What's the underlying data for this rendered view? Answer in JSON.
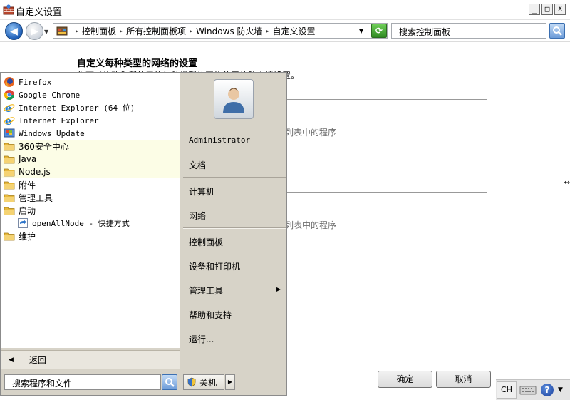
{
  "window": {
    "title": "自定义设置",
    "min_label": "_",
    "max_label": "□",
    "close_label": "X"
  },
  "navigation": {
    "back_glyph": "◀",
    "forward_glyph": "▶",
    "history_glyph": "▼",
    "breadcrumbs": [
      "控制面板",
      "所有控制面板项",
      "Windows 防火墙",
      "自定义设置"
    ],
    "crumb_separator": "▸",
    "dropdown_glyph": "▼",
    "refresh_glyph": "⟳",
    "search_placeholder": "搜索控制面板"
  },
  "content": {
    "heading": "自定义每种类型的网络的设置",
    "description": "您可以修改您所使用的每种类型的网络位置的防火墙设置。",
    "section1_text": "列表中的程序",
    "section2_text": "列表中的程序",
    "ok_label": "确定",
    "cancel_label": "取消",
    "edge_glyph": "↔"
  },
  "start_menu": {
    "programs": [
      {
        "label": "Firefox",
        "icon": "firefox-icon",
        "type": "app"
      },
      {
        "label": "Google Chrome",
        "icon": "chrome-icon",
        "type": "app"
      },
      {
        "label": "Internet Explorer (64 位)",
        "icon": "ie-icon",
        "type": "app"
      },
      {
        "label": "Internet Explorer",
        "icon": "ie-icon",
        "type": "app"
      },
      {
        "label": "Windows Update",
        "icon": "windows-update-icon",
        "type": "app"
      },
      {
        "label": "360安全中心",
        "icon": "folder-icon",
        "type": "folder",
        "highlight": true
      },
      {
        "label": "Java",
        "icon": "folder-icon",
        "type": "folder",
        "highlight": true
      },
      {
        "label": "Node.js",
        "icon": "folder-icon",
        "type": "folder",
        "highlight": true
      },
      {
        "label": "附件",
        "icon": "folder-icon",
        "type": "folder"
      },
      {
        "label": "管理工具",
        "icon": "folder-icon",
        "type": "folder"
      },
      {
        "label": "启动",
        "icon": "folder-icon",
        "type": "folder"
      },
      {
        "label": "openAllNode - 快捷方式",
        "icon": "shortcut-icon",
        "type": "sub"
      },
      {
        "label": "维护",
        "icon": "folder-icon",
        "type": "folder"
      }
    ],
    "back_glyph": "◀",
    "back_label": "返回",
    "search_placeholder": "搜索程序和文件",
    "user_name": "Administrator",
    "right_items": {
      "documents": "文档",
      "computer": "计算机",
      "network": "网络",
      "control_panel": "控制面板",
      "devices_printers": "设备和打印机",
      "admin_tools": "管理工具",
      "help_support": "帮助和支持",
      "run": "运行..."
    },
    "submenu_glyph": "▶",
    "shutdown_label": "关机",
    "shutdown_arrow_glyph": "▶"
  },
  "tray": {
    "language": "CH",
    "help_glyph": "?",
    "dropdown_glyph": "▼"
  },
  "colors": {
    "highlight_row": "#fcfde6",
    "start_menu_bg": "#d7d3c8",
    "nav_blue": "#1f5fb8"
  }
}
